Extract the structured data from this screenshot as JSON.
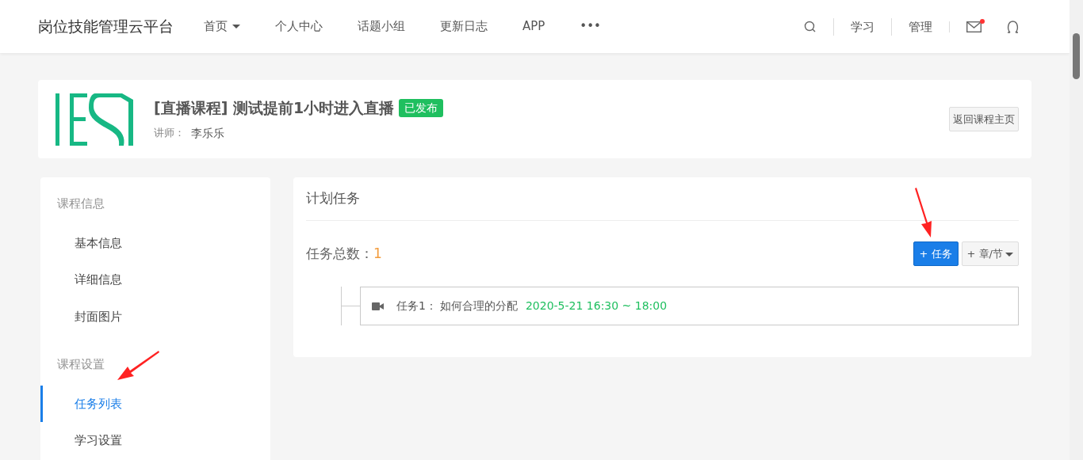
{
  "navbar": {
    "brand": "岗位技能管理云平台",
    "menu": [
      {
        "label": "首页",
        "dropdown": true
      },
      {
        "label": "个人中心",
        "dropdown": false
      },
      {
        "label": "话题小组",
        "dropdown": false
      },
      {
        "label": "更新日志",
        "dropdown": false
      },
      {
        "label": "APP",
        "dropdown": false
      },
      {
        "label": "•••",
        "dropdown": false
      }
    ],
    "right_links": [
      "学习",
      "管理"
    ],
    "mail_unread": true
  },
  "course": {
    "type_tag": "[直播课程]",
    "title": "测试提前1小时进入直播",
    "status": "已发布",
    "teacher_label": "讲师：",
    "teacher": "李乐乐",
    "back_button": "返回课程主页"
  },
  "sidebar": {
    "groups": [
      {
        "title": "课程信息",
        "items": [
          {
            "label": "基本信息",
            "selected": false
          },
          {
            "label": "详细信息",
            "selected": false
          },
          {
            "label": "封面图片",
            "selected": false
          }
        ]
      },
      {
        "title": "课程设置",
        "items": [
          {
            "label": "任务列表",
            "selected": true
          },
          {
            "label": "学习设置",
            "selected": false
          }
        ]
      }
    ]
  },
  "panel": {
    "title": "计划任务",
    "count_label": "任务总数：",
    "count": "1",
    "add_task_button": "+ 任务",
    "add_chapter_button": "+ 章/节",
    "tasks": [
      {
        "name": "任务1：",
        "title": "如何合理的分配",
        "time": "2020-5-21 16:30 ~ 18:00"
      }
    ]
  }
}
